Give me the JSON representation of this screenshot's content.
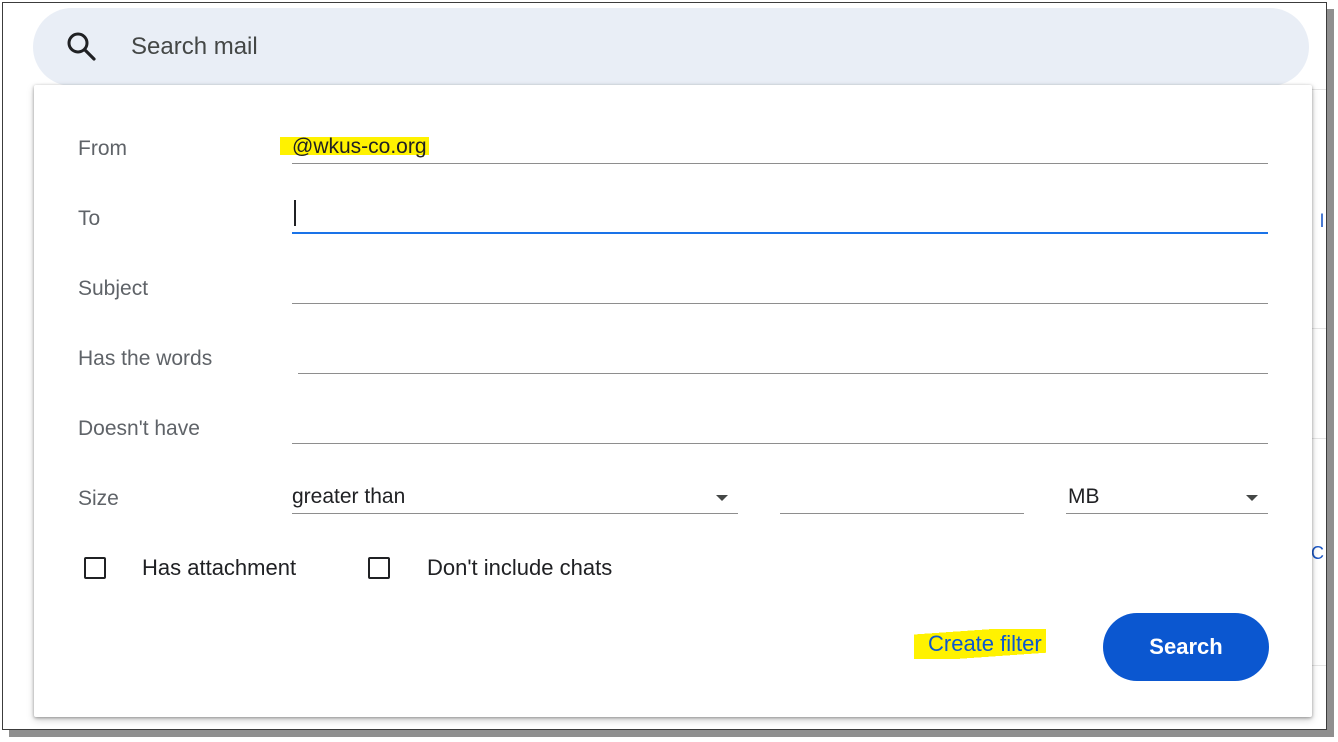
{
  "search": {
    "placeholder": "Search mail",
    "icon": "search-icon"
  },
  "filter_form": {
    "from": {
      "label": "From",
      "value": "@wkus-co.org"
    },
    "to": {
      "label": "To",
      "value": ""
    },
    "subject": {
      "label": "Subject",
      "value": ""
    },
    "has_words": {
      "label": "Has the words",
      "value": ""
    },
    "doesnt_have": {
      "label": "Doesn't have",
      "value": ""
    },
    "size": {
      "label": "Size",
      "comparator": "greater than",
      "amount": "",
      "unit": "MB"
    },
    "has_attachment": {
      "label": "Has attachment",
      "checked": false
    },
    "dont_include_chats": {
      "label": "Don't include chats",
      "checked": false
    }
  },
  "actions": {
    "create_filter": "Create filter",
    "search": "Search"
  },
  "colors": {
    "accent": "#0b57d0",
    "highlight": "#fff200",
    "searchbar_bg": "#e9eef6"
  },
  "background_fragments": {
    "frag_1": "l",
    "frag_2": "C"
  }
}
